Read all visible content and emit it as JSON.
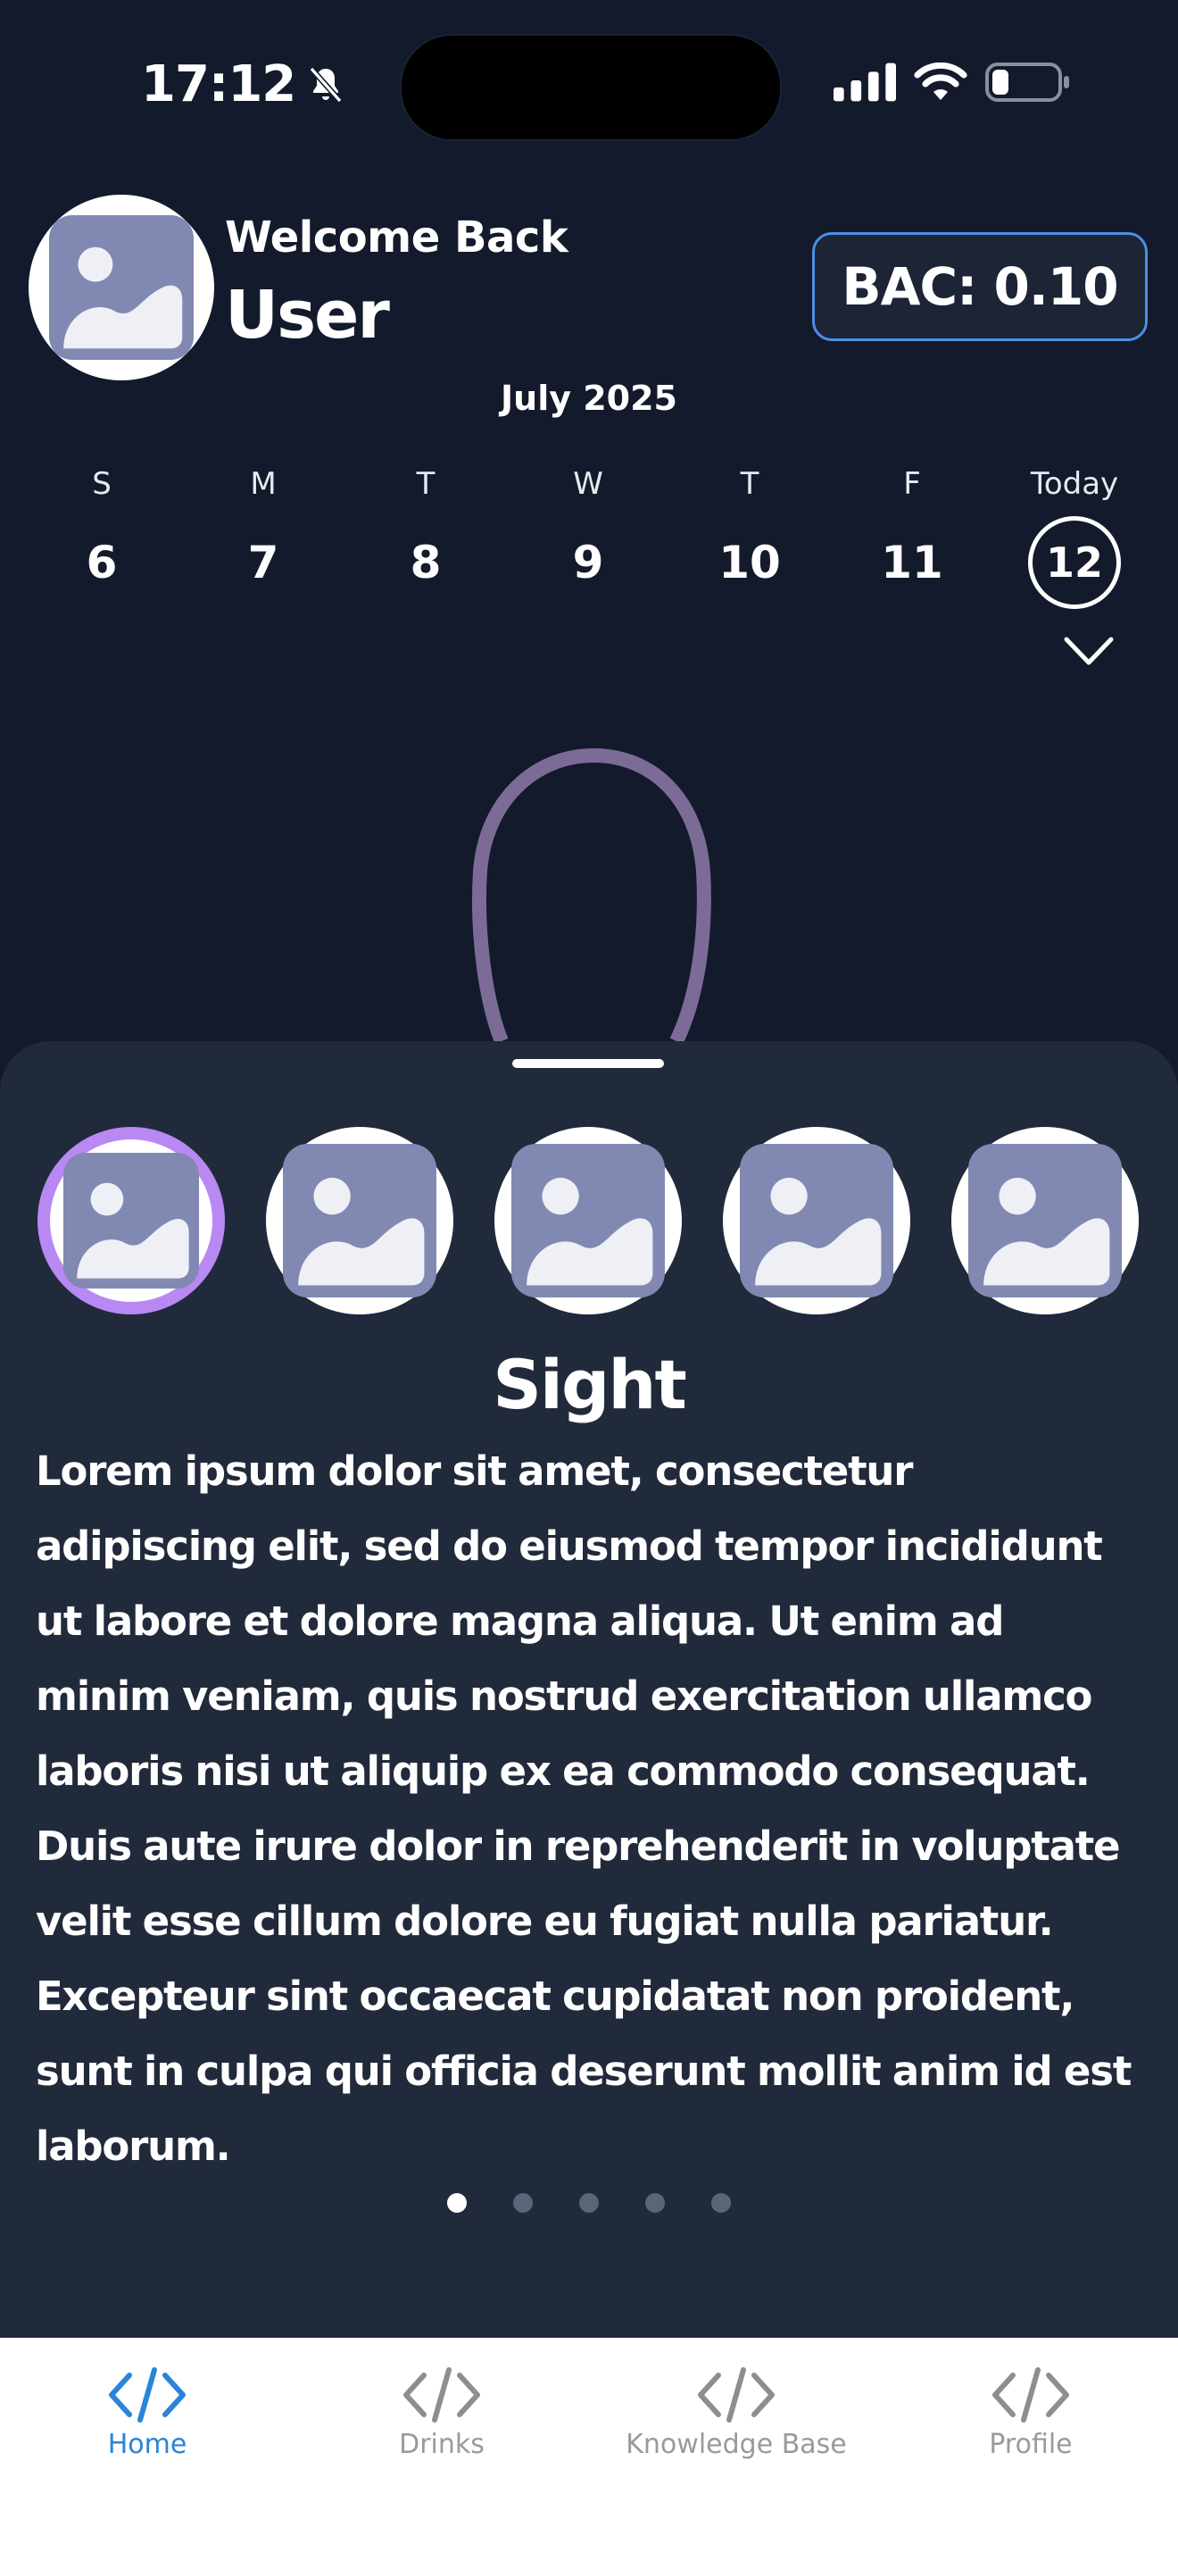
{
  "status_bar": {
    "time": "17:12"
  },
  "header": {
    "welcome": "Welcome Back",
    "username": "User",
    "bac": "BAC: 0.10"
  },
  "calendar": {
    "month": "July 2025",
    "days": [
      {
        "label": "S",
        "num": "6"
      },
      {
        "label": "M",
        "num": "7"
      },
      {
        "label": "T",
        "num": "8"
      },
      {
        "label": "W",
        "num": "9"
      },
      {
        "label": "T",
        "num": "10"
      },
      {
        "label": "F",
        "num": "11"
      },
      {
        "label": "Today",
        "num": "12"
      }
    ]
  },
  "sheet": {
    "title": "Sight",
    "body": "Lorem ipsum dolor sit amet, consectetur adipiscing elit, sed do eiusmod tempor incididunt ut labore et dolore magna aliqua. Ut enim ad minim veniam, quis nostrud exercitation ullamco laboris nisi ut aliquip ex ea commodo consequat. Duis aute irure dolor in reprehenderit in voluptate velit esse cillum dolore eu fugiat nulla pariatur. Excepteur sint occaecat cupidatat non proident, sunt in culpa qui officia deserunt mollit anim id est laborum.",
    "selected_index": 0,
    "page_count": 5,
    "active_page": 0
  },
  "tabs": [
    {
      "label": "Home",
      "icon": "code-icon",
      "active": true
    },
    {
      "label": "Drinks",
      "icon": "code-icon",
      "active": false
    },
    {
      "label": "Knowledge Base",
      "icon": "code-icon",
      "active": false
    },
    {
      "label": "Profile",
      "icon": "code-icon",
      "active": false
    }
  ],
  "colors": {
    "background": "#131a2b",
    "sheet": "#212a3b",
    "accent_blue": "#4a90e2",
    "selection_purple": "#b889f2",
    "head_outline": "#7c6b97",
    "tab_active": "#2a84d8",
    "tab_inactive": "#9a9a9a"
  }
}
